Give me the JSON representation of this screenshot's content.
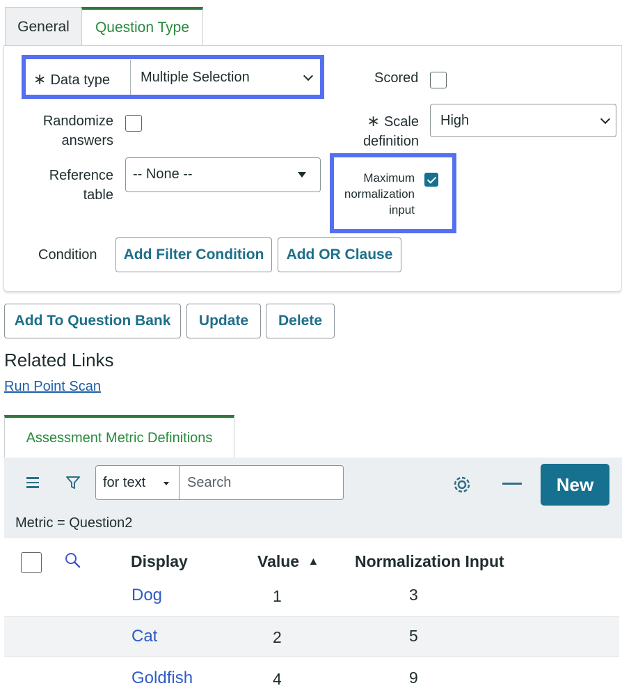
{
  "tabs": [
    {
      "label": "General",
      "active": false
    },
    {
      "label": "Question Type",
      "active": true
    }
  ],
  "form": {
    "required_mark": "∗",
    "data_type_label": "Data type",
    "data_type_value": "Multiple Selection",
    "scored_label": "Scored",
    "randomize_label_1": "Randomize",
    "randomize_label_2": "answers",
    "scale_label_1": "Scale",
    "scale_label_2": "definition",
    "scale_value": "High",
    "reference_label_1": "Reference",
    "reference_label_2": "table",
    "reference_value": "-- None --",
    "maxnorm_label_1": "Maximum",
    "maxnorm_label_2": "normalization",
    "maxnorm_label_3": "input",
    "maxnorm_checked": true,
    "condition_label": "Condition",
    "add_filter_label": "Add Filter Condition",
    "add_or_label": "Add OR Clause"
  },
  "actions": {
    "add_to_bank": "Add To Question Bank",
    "update": "Update",
    "delete": "Delete"
  },
  "related": {
    "title": "Related Links",
    "link": "Run Point Scan"
  },
  "list": {
    "tab_label": "Assessment Metric Definitions",
    "search_field": "for text",
    "search_placeholder": "Search",
    "new_label": "New",
    "breadcrumb": "Metric = Question2",
    "columns": {
      "display": "Display",
      "value": "Value",
      "norm": "Normalization Input"
    },
    "sort_indicator": "▲",
    "rows": [
      {
        "display": "Dog",
        "value": "1",
        "norm": "3"
      },
      {
        "display": "Cat",
        "value": "2",
        "norm": "5"
      },
      {
        "display": "Goldfish",
        "value": "4",
        "norm": "9"
      }
    ]
  },
  "colors": {
    "accent": "#15718f",
    "highlight": "#5470f0",
    "active_tab": "#2a8a3d",
    "link": "#2f5cc4"
  }
}
